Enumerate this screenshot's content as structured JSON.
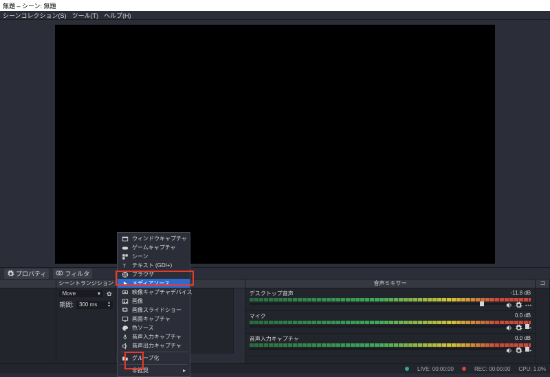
{
  "title": "無題 – シーン: 無題",
  "menus": [
    "シーンコレクション(S)",
    "ツール(T)",
    "ヘルプ(H)"
  ],
  "toolbar": {
    "properties": "プロパティ",
    "filters": "フィルタ"
  },
  "panels": {
    "scenes": "",
    "transitions": {
      "title": "シーントランジション",
      "select": "Move",
      "duration_label": "期間:",
      "duration": "300 ms"
    },
    "sources": {
      "title": ""
    },
    "mixer": {
      "title": "音声ミキサー",
      "channels": [
        {
          "name": "デスクトップ音声",
          "db": "-11.8 dB",
          "pos": 82
        },
        {
          "name": "マイク",
          "db": "0.0 dB",
          "pos": 98
        },
        {
          "name": "音声入力キャプチャ",
          "db": "0.0 dB",
          "pos": 98
        }
      ]
    },
    "controls": {
      "title": "コ"
    }
  },
  "context": {
    "items": [
      {
        "icon": "window",
        "label": "ウィンドウキャプチャ"
      },
      {
        "icon": "gamepad",
        "label": "ゲームキャプチャ"
      },
      {
        "icon": "scene",
        "label": "シーン"
      },
      {
        "icon": "text",
        "label": "テキスト (GDI+)"
      },
      {
        "icon": "globe",
        "label": "ブラウザ"
      },
      {
        "icon": "media",
        "label": "メディアソース",
        "highlight": true
      },
      {
        "icon": "ndi",
        "label": "映像キャプチャデバイス"
      },
      {
        "icon": "image",
        "label": "画像"
      },
      {
        "icon": "slideshow",
        "label": "画像スライドショー"
      },
      {
        "icon": "display",
        "label": "画面キャプチャ"
      },
      {
        "icon": "color",
        "label": "色ソース"
      },
      {
        "icon": "audio-in",
        "label": "音声入力キャプチャ"
      },
      {
        "icon": "audio-out",
        "label": "音声出力キャプチャ"
      }
    ],
    "group": "グループ化",
    "deprecated": "非推奨"
  },
  "status": {
    "live": "LIVE: 00:00:00",
    "rec": "REC: 00:00:00",
    "cpu": "CPU: 1.0%"
  }
}
